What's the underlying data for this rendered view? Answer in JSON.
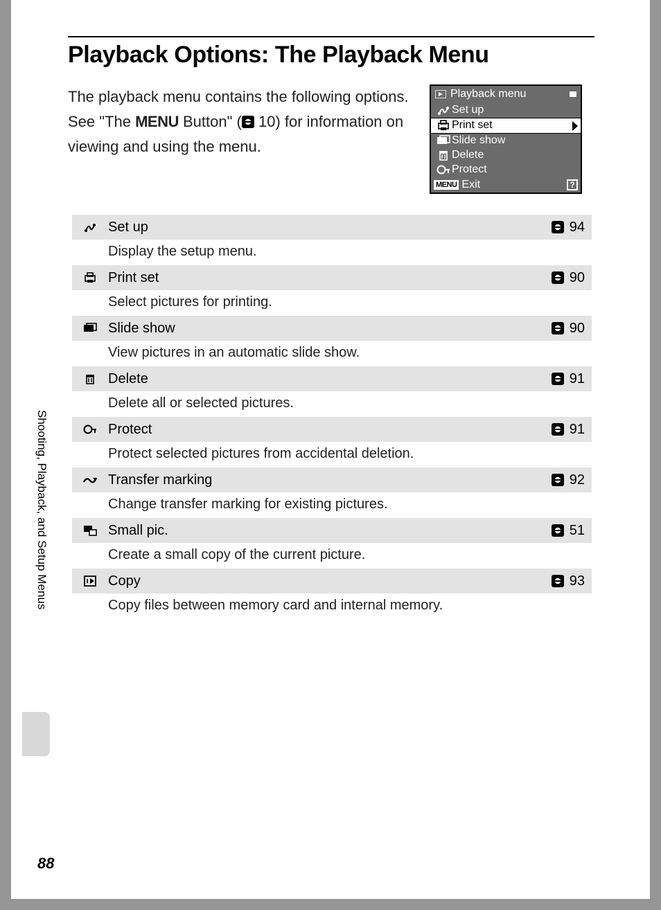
{
  "title": "Playback Options: The Playback Menu",
  "intro_line1": "The playback menu contains the following options.",
  "intro_prefix": "See \"The ",
  "intro_menu_word": "MENU",
  "intro_middle": " Button\" (",
  "intro_ref_num": " 10",
  "intro_suffix": ") for information on viewing and using the menu.",
  "menu_shot": {
    "header": "Playback menu",
    "rows": [
      {
        "label": "Set up",
        "selected": false
      },
      {
        "label": "Print set",
        "selected": true
      },
      {
        "label": "Slide show",
        "selected": false
      },
      {
        "label": "Delete",
        "selected": false
      },
      {
        "label": "Protect",
        "selected": false
      }
    ],
    "exit_badge": "MENU",
    "exit_label": "Exit",
    "help": "?"
  },
  "options": [
    {
      "icon": "setup",
      "name": "Set up",
      "page": "94",
      "desc": "Display the setup menu."
    },
    {
      "icon": "print",
      "name": "Print set",
      "page": "90",
      "desc": "Select pictures for printing."
    },
    {
      "icon": "slide",
      "name": "Slide show",
      "page": "90",
      "desc": "View pictures in an automatic slide show."
    },
    {
      "icon": "delete",
      "name": "Delete",
      "page": "91",
      "desc": "Delete all or selected pictures."
    },
    {
      "icon": "protect",
      "name": "Protect",
      "page": "91",
      "desc": "Protect selected pictures from accidental deletion."
    },
    {
      "icon": "transfer",
      "name": "Transfer marking",
      "page": "92",
      "desc": "Change transfer marking for existing pictures."
    },
    {
      "icon": "smallpic",
      "name": "Small pic.",
      "page": "51",
      "desc": "Create a small copy of the current picture."
    },
    {
      "icon": "copy",
      "name": "Copy",
      "page": "93",
      "desc": "Copy files between memory card and internal memory."
    }
  ],
  "sidebar": "Shooting, Playback, and Setup Menus",
  "page_number": "88"
}
